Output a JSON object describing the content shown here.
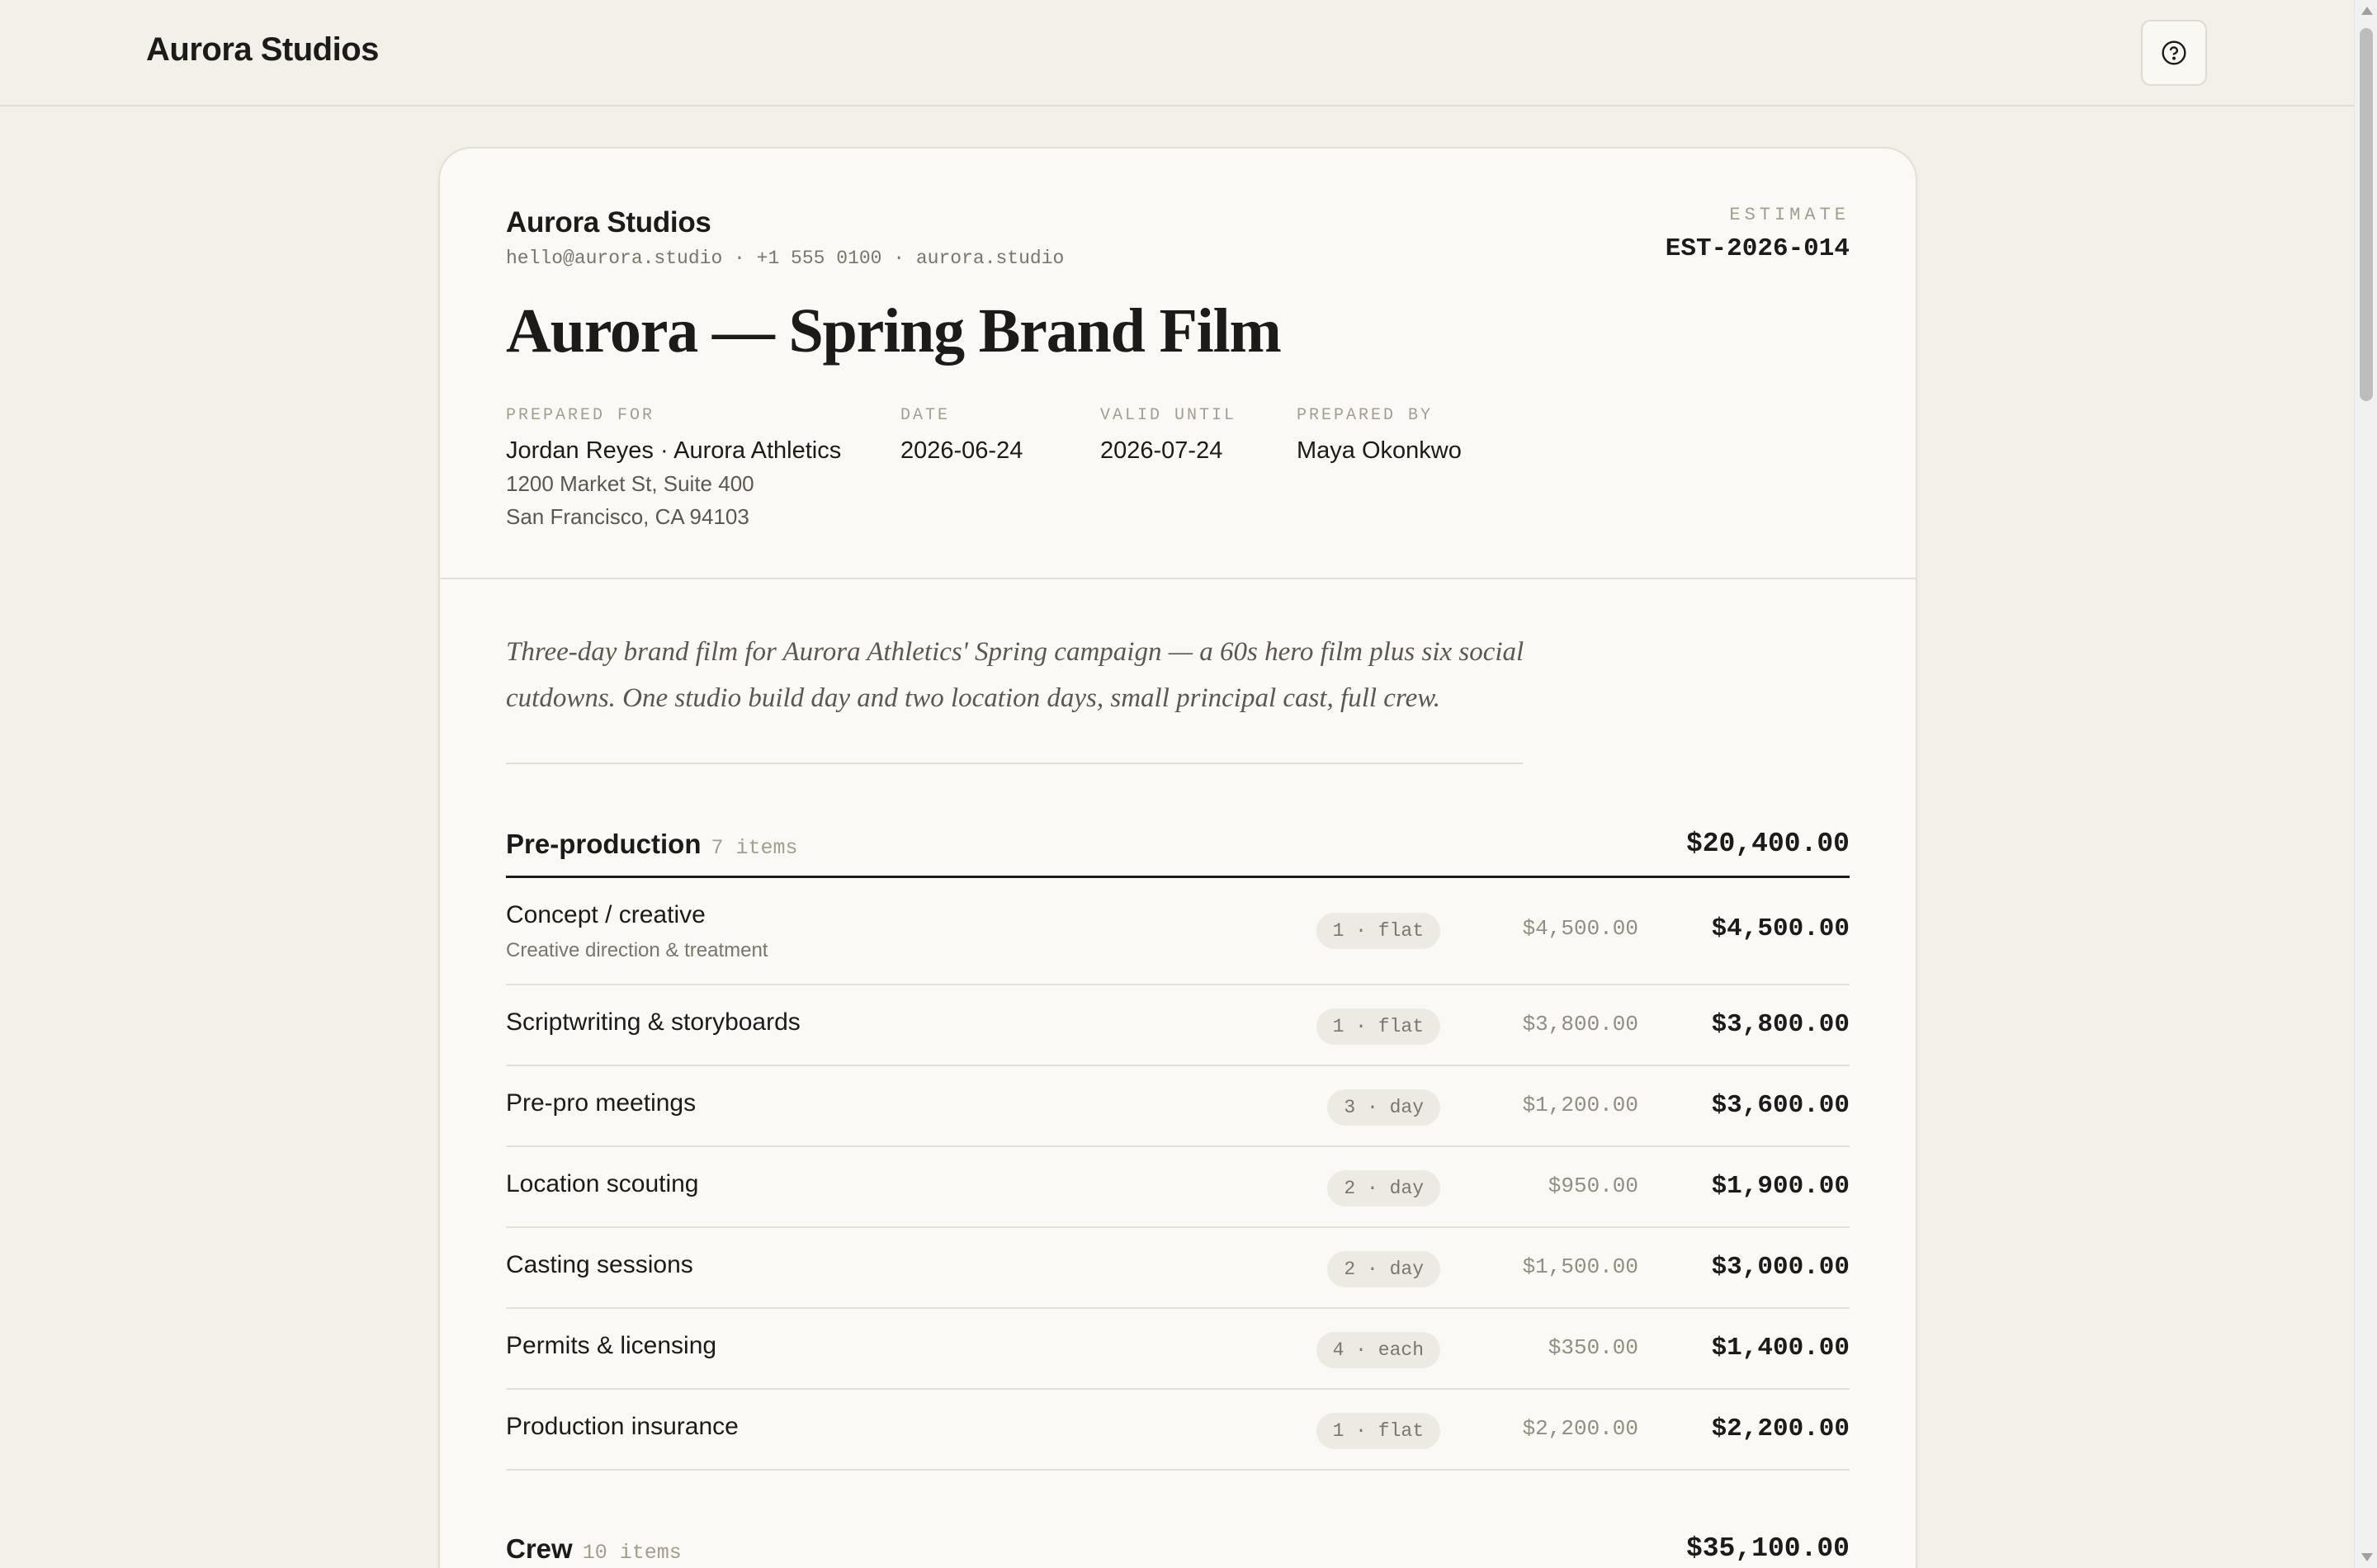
{
  "header": {
    "brand": "Aurora Studios",
    "help_icon": "question-circle-icon"
  },
  "estimate": {
    "studio_name": "Aurora Studios",
    "contact": "hello@aurora.studio · +1 555 0100 · aurora.studio",
    "doc_label": "ESTIMATE",
    "doc_number": "EST-2026-014",
    "title": "Aurora — Spring Brand Film",
    "meta": {
      "prepared_for_label": "PREPARED FOR",
      "prepared_for": "Jordan Reyes · Aurora Athletics",
      "address_line1": "1200 Market St, Suite 400",
      "address_line2": "San Francisco, CA 94103",
      "date_label": "DATE",
      "date": "2026-06-24",
      "valid_until_label": "VALID UNTIL",
      "valid_until": "2026-07-24",
      "prepared_by_label": "PREPARED BY",
      "prepared_by": "Maya Okonkwo"
    },
    "summary": "Three-day brand film for Aurora Athletics' Spring campaign — a 60s hero film plus six social cutdowns. One studio build day and two location days, small principal cast, full crew.",
    "sections": [
      {
        "title": "Pre-production",
        "count": "7 items",
        "total": "$20,400.00",
        "items": [
          {
            "name": "Concept / creative",
            "desc": "Creative direction & treatment",
            "qty": "1 · flat",
            "rate": "$4,500.00",
            "amount": "$4,500.00"
          },
          {
            "name": "Scriptwriting & storyboards",
            "qty": "1 · flat",
            "rate": "$3,800.00",
            "amount": "$3,800.00"
          },
          {
            "name": "Pre-pro meetings",
            "qty": "3 · day",
            "rate": "$1,200.00",
            "amount": "$3,600.00"
          },
          {
            "name": "Location scouting",
            "qty": "2 · day",
            "rate": "$950.00",
            "amount": "$1,900.00"
          },
          {
            "name": "Casting sessions",
            "qty": "2 · day",
            "rate": "$1,500.00",
            "amount": "$3,000.00"
          },
          {
            "name": "Permits & licensing",
            "qty": "4 · each",
            "rate": "$350.00",
            "amount": "$1,400.00"
          },
          {
            "name": "Production insurance",
            "qty": "1 · flat",
            "rate": "$2,200.00",
            "amount": "$2,200.00"
          }
        ]
      },
      {
        "title": "Crew",
        "count": "10 items",
        "total": "$35,100.00"
      }
    ]
  }
}
